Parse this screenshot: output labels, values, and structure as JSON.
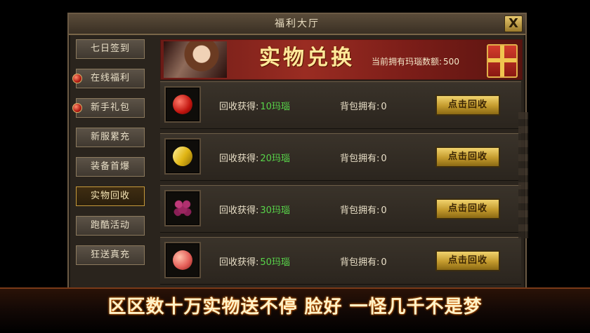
{
  "window": {
    "title": "福利大厅",
    "close_label": "X"
  },
  "nav": {
    "items": [
      {
        "label": "七日签到",
        "has_dot": false,
        "active": false
      },
      {
        "label": "在线福利",
        "has_dot": true,
        "active": false
      },
      {
        "label": "新手礼包",
        "has_dot": true,
        "active": false
      },
      {
        "label": "新服累充",
        "has_dot": false,
        "active": false
      },
      {
        "label": "装备首爆",
        "has_dot": false,
        "active": false
      },
      {
        "label": "实物回收",
        "has_dot": false,
        "active": true
      },
      {
        "label": "跑酷活动",
        "has_dot": false,
        "active": false
      },
      {
        "label": "狂送真充",
        "has_dot": false,
        "active": false
      }
    ]
  },
  "banner": {
    "title": "实物兑换",
    "balance_label": "当前拥有玛瑙数额:",
    "balance_value": "500"
  },
  "rows": [
    {
      "icon": "apple-icon",
      "recycle_label": "回收获得:",
      "reward": "10玛瑙",
      "have_label": "背包拥有:",
      "have_value": "0",
      "button": "点击回收"
    },
    {
      "icon": "banana-icon",
      "recycle_label": "回收获得:",
      "reward": "20玛瑙",
      "have_label": "背包拥有:",
      "have_value": "0",
      "button": "点击回收"
    },
    {
      "icon": "grape-icon",
      "recycle_label": "回收获得:",
      "reward": "30玛瑙",
      "have_label": "背包拥有:",
      "have_value": "0",
      "button": "点击回收"
    },
    {
      "icon": "peach-icon",
      "recycle_label": "回收获得:",
      "reward": "50玛瑙",
      "have_label": "背包拥有:",
      "have_value": "0",
      "button": "点击回收"
    }
  ],
  "caption": "区区数十万实物送不停 脸好 一怪几千不是梦"
}
